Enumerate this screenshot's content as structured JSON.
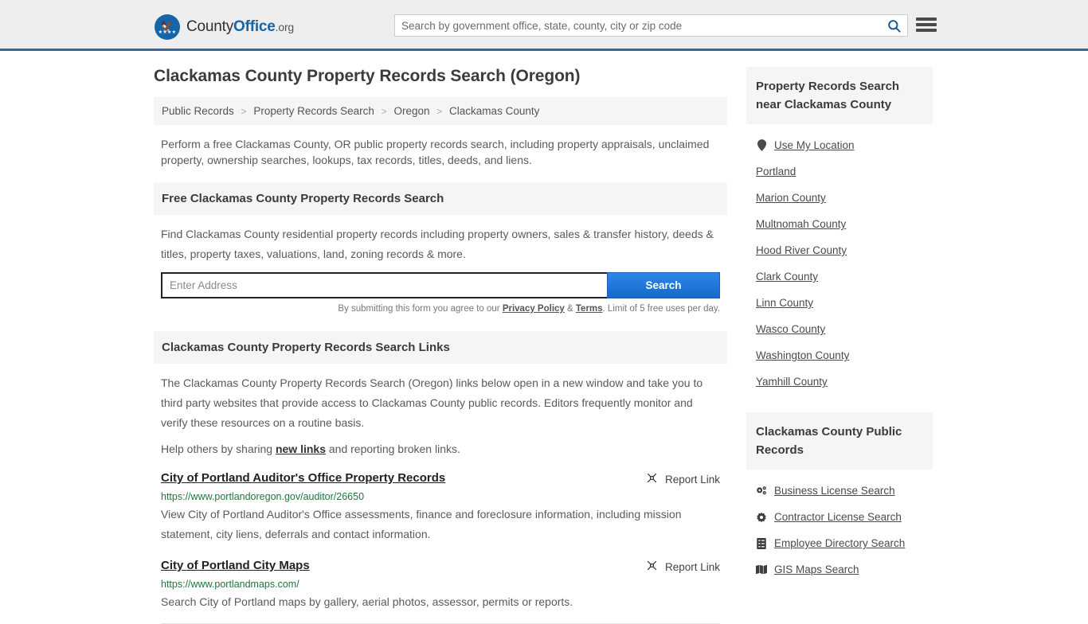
{
  "header": {
    "brand": {
      "county": "County",
      "office": "Office",
      "org": ".org",
      "logo_icon": "eagle-seal-icon"
    },
    "search": {
      "placeholder": "Search by government office, state, county, city or zip code",
      "value": "",
      "icon": "search-icon"
    },
    "menu_icon": "hamburger-menu-icon"
  },
  "page": {
    "title": "Clackamas County Property Records Search (Oregon)",
    "intro": "Perform a free Clackamas County, OR public property records search, including property appraisals, unclaimed property, ownership searches, lookups, tax records, titles, deeds, and liens."
  },
  "breadcrumb": {
    "items": [
      "Public Records",
      "Property Records Search",
      "Oregon",
      "Clackamas County"
    ],
    "separator": ">"
  },
  "search_panel": {
    "heading": "Free Clackamas County Property Records Search",
    "description": "Find Clackamas County residential property records including property owners, sales & transfer history, deeds & titles, property taxes, valuations, land, zoning records & more.",
    "address_placeholder": "Enter Address",
    "address_value": "",
    "submit_label": "Search",
    "note_prefix": "By submitting this form you agree to our ",
    "note_privacy": "Privacy Policy",
    "note_amp": " & ",
    "note_terms": "Terms",
    "note_suffix": ". Limit of 5 free uses per day."
  },
  "links_panel": {
    "heading": "Clackamas County Property Records Search Links",
    "paragraph": "The Clackamas County Property Records Search (Oregon) links below open in a new window and take you to third party websites that provide access to Clackamas County public records. Editors frequently monitor and verify these resources on a routine basis.",
    "help_prefix": "Help others by sharing ",
    "help_link": "new links",
    "help_suffix": " and reporting broken links.",
    "report_label": "Report Link",
    "report_icon": "broken-link-icon",
    "results": [
      {
        "title": "City of Portland Auditor's Office Property Records",
        "url": "https://www.portlandoregon.gov/auditor/26650",
        "description": "View City of Portland Auditor's Office assessments, finance and foreclosure information, including mission statement, city liens, deferrals and contact information."
      },
      {
        "title": "City of Portland City Maps",
        "url": "https://www.portlandmaps.com/",
        "description": "Search City of Portland maps by gallery, aerial photos, assessor, permits or reports."
      }
    ]
  },
  "sidebar": {
    "nearby": {
      "heading": "Property Records Search near Clackamas County",
      "items": [
        {
          "label": "Use My Location",
          "icon": "map-pin-icon"
        },
        {
          "label": "Portland",
          "icon": ""
        },
        {
          "label": "Marion County",
          "icon": ""
        },
        {
          "label": "Multnomah County",
          "icon": ""
        },
        {
          "label": "Hood River County",
          "icon": ""
        },
        {
          "label": "Clark County",
          "icon": ""
        },
        {
          "label": "Linn County",
          "icon": ""
        },
        {
          "label": "Wasco County",
          "icon": ""
        },
        {
          "label": "Washington County",
          "icon": ""
        },
        {
          "label": "Yamhill County",
          "icon": ""
        }
      ]
    },
    "public_records": {
      "heading": "Clackamas County Public Records",
      "items": [
        {
          "label": "Business License Search",
          "icon": "cogs-icon"
        },
        {
          "label": "Contractor License Search",
          "icon": "gear-icon"
        },
        {
          "label": "Employee Directory Search",
          "icon": "list-icon"
        },
        {
          "label": "GIS Maps Search",
          "icon": "map-icon"
        }
      ]
    }
  },
  "colors": {
    "header_bg": "#eeeeee",
    "header_border": "#2e6da4",
    "brand_blue": "#1565a8",
    "button_blue": "#1668cc",
    "url_green": "#1a7a3c",
    "panel_gray": "#f5f5f5"
  }
}
